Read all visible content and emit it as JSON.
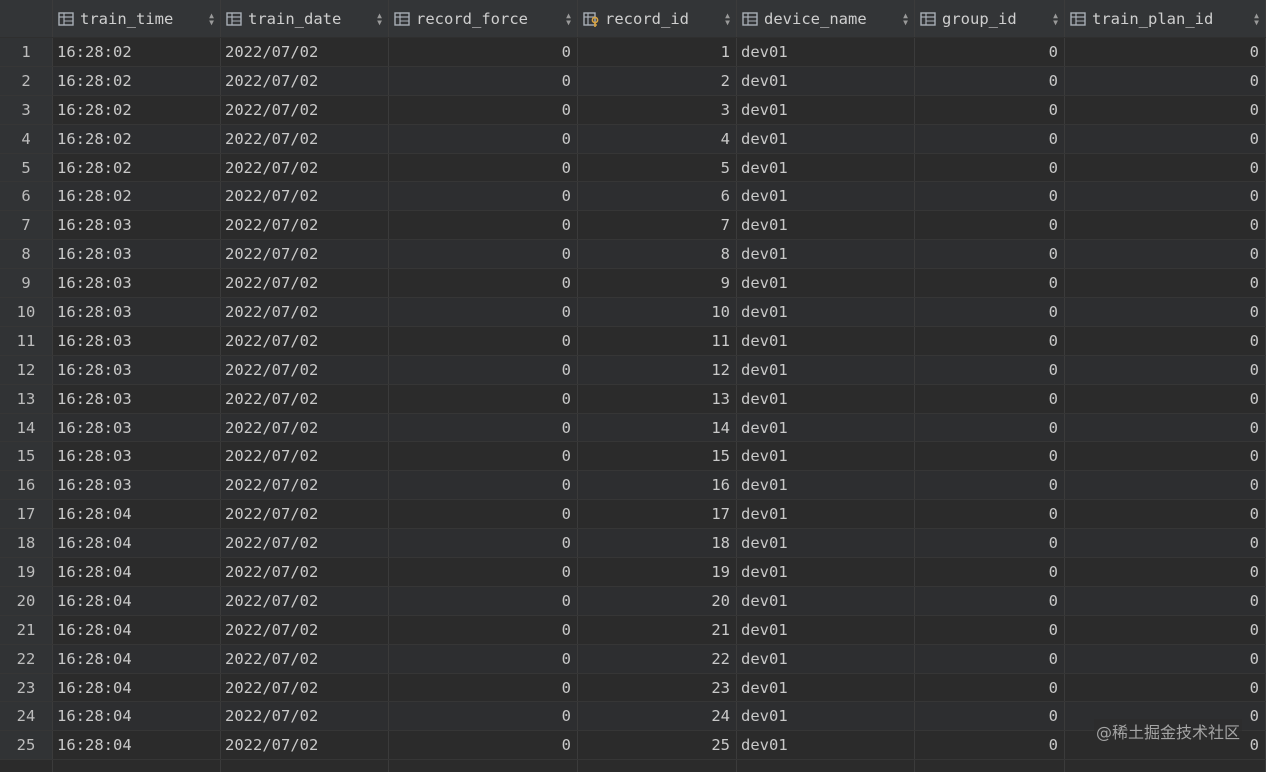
{
  "columns": [
    {
      "name": "train_time",
      "icon": "column-icon",
      "align": "left"
    },
    {
      "name": "train_date",
      "icon": "column-icon",
      "align": "left"
    },
    {
      "name": "record_force",
      "icon": "column-icon",
      "align": "right"
    },
    {
      "name": "record_id",
      "icon": "primary-key-column-icon",
      "align": "right"
    },
    {
      "name": "device_name",
      "icon": "column-icon",
      "align": "left"
    },
    {
      "name": "group_id",
      "icon": "column-icon",
      "align": "right"
    },
    {
      "name": "train_plan_id",
      "icon": "column-icon",
      "align": "right"
    }
  ],
  "rows": [
    [
      "1",
      "16:28:02",
      "2022/07/02",
      "0",
      "1",
      "dev01",
      "0",
      "0"
    ],
    [
      "2",
      "16:28:02",
      "2022/07/02",
      "0",
      "2",
      "dev01",
      "0",
      "0"
    ],
    [
      "3",
      "16:28:02",
      "2022/07/02",
      "0",
      "3",
      "dev01",
      "0",
      "0"
    ],
    [
      "4",
      "16:28:02",
      "2022/07/02",
      "0",
      "4",
      "dev01",
      "0",
      "0"
    ],
    [
      "5",
      "16:28:02",
      "2022/07/02",
      "0",
      "5",
      "dev01",
      "0",
      "0"
    ],
    [
      "6",
      "16:28:02",
      "2022/07/02",
      "0",
      "6",
      "dev01",
      "0",
      "0"
    ],
    [
      "7",
      "16:28:03",
      "2022/07/02",
      "0",
      "7",
      "dev01",
      "0",
      "0"
    ],
    [
      "8",
      "16:28:03",
      "2022/07/02",
      "0",
      "8",
      "dev01",
      "0",
      "0"
    ],
    [
      "9",
      "16:28:03",
      "2022/07/02",
      "0",
      "9",
      "dev01",
      "0",
      "0"
    ],
    [
      "10",
      "16:28:03",
      "2022/07/02",
      "0",
      "10",
      "dev01",
      "0",
      "0"
    ],
    [
      "11",
      "16:28:03",
      "2022/07/02",
      "0",
      "11",
      "dev01",
      "0",
      "0"
    ],
    [
      "12",
      "16:28:03",
      "2022/07/02",
      "0",
      "12",
      "dev01",
      "0",
      "0"
    ],
    [
      "13",
      "16:28:03",
      "2022/07/02",
      "0",
      "13",
      "dev01",
      "0",
      "0"
    ],
    [
      "14",
      "16:28:03",
      "2022/07/02",
      "0",
      "14",
      "dev01",
      "0",
      "0"
    ],
    [
      "15",
      "16:28:03",
      "2022/07/02",
      "0",
      "15",
      "dev01",
      "0",
      "0"
    ],
    [
      "16",
      "16:28:03",
      "2022/07/02",
      "0",
      "16",
      "dev01",
      "0",
      "0"
    ],
    [
      "17",
      "16:28:04",
      "2022/07/02",
      "0",
      "17",
      "dev01",
      "0",
      "0"
    ],
    [
      "18",
      "16:28:04",
      "2022/07/02",
      "0",
      "18",
      "dev01",
      "0",
      "0"
    ],
    [
      "19",
      "16:28:04",
      "2022/07/02",
      "0",
      "19",
      "dev01",
      "0",
      "0"
    ],
    [
      "20",
      "16:28:04",
      "2022/07/02",
      "0",
      "20",
      "dev01",
      "0",
      "0"
    ],
    [
      "21",
      "16:28:04",
      "2022/07/02",
      "0",
      "21",
      "dev01",
      "0",
      "0"
    ],
    [
      "22",
      "16:28:04",
      "2022/07/02",
      "0",
      "22",
      "dev01",
      "0",
      "0"
    ],
    [
      "23",
      "16:28:04",
      "2022/07/02",
      "0",
      "23",
      "dev01",
      "0",
      "0"
    ],
    [
      "24",
      "16:28:04",
      "2022/07/02",
      "0",
      "24",
      "dev01",
      "0",
      "0"
    ],
    [
      "25",
      "16:28:04",
      "2022/07/02",
      "0",
      "25",
      "dev01",
      "0",
      "0"
    ]
  ],
  "watermark": "@稀土掘金技术社区",
  "colors": {
    "background": "#2b2b2b",
    "header": "#333537",
    "text": "#c9c9c9",
    "key_icon": "#d9a441"
  }
}
